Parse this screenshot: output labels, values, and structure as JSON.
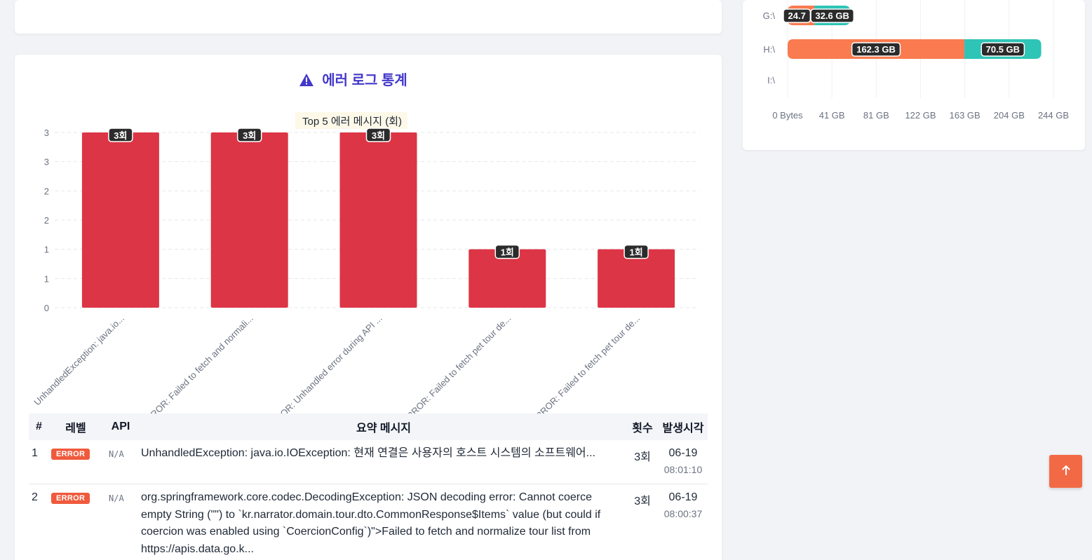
{
  "error_section": {
    "title": "에러 로그 통계",
    "icon": "warning-triangle-icon",
    "accent_color": "#4338ca"
  },
  "chart_data": [
    {
      "type": "bar",
      "title": "Top 5 에러 메시지 (회)",
      "categories": [
        "UnhandledException: java.io...",
        "ERROR: Failed to fetch and normali...",
        "ERROR: Unhandled error during API ...",
        "ERROR: Failed to fetch pet tour de...",
        "ERROR: Failed to fetch pet tour de..."
      ],
      "values": [
        3,
        3,
        3,
        1,
        1
      ],
      "data_labels": [
        "3회",
        "3회",
        "3회",
        "1회",
        "1회"
      ],
      "yticks": [
        "0",
        "1",
        "1",
        "2",
        "2",
        "3",
        "3"
      ],
      "ylim": [
        0,
        3
      ],
      "grid": true,
      "color": "#dc3545"
    },
    {
      "type": "bar",
      "orientation": "horizontal",
      "stacked": true,
      "categories": [
        "G:\\",
        "H:\\",
        "I:\\"
      ],
      "series": [
        {
          "values": [
            24.7,
            162.3,
            0
          ],
          "labels": [
            "24.7",
            "162.3 GB",
            ""
          ],
          "color": "#f97b4f"
        },
        {
          "values": [
            32.6,
            70.5,
            0
          ],
          "labels": [
            "32.6 GB",
            "70.5 GB",
            ""
          ],
          "color": "#2ec4b6"
        }
      ],
      "xticks": [
        "0 Bytes",
        "41 GB",
        "81 GB",
        "122 GB",
        "163 GB",
        "204 GB",
        "244 GB"
      ],
      "xlim": [
        0,
        244
      ],
      "grid": true
    }
  ],
  "table": {
    "headers": [
      "#",
      "레벨",
      "API",
      "요약 메시지",
      "횟수",
      "발생시각"
    ],
    "rows": [
      {
        "index": "1",
        "level": "ERROR",
        "api": "N/A",
        "message": "UnhandledException: java.io.IOException: 현재 연결은 사용자의 호스트 시스템의 소프트웨어...",
        "count": "3회",
        "date": "06-19",
        "time": "08:01:10"
      },
      {
        "index": "2",
        "level": "ERROR",
        "api": "N/A",
        "message": "org.springframework.core.codec.DecodingException: JSON decoding error: Cannot coerce empty String (\"\") to `kr.narrator.domain.tour.dto.CommonResponse$Items` value (but could if coercion was enabled using `CoercionConfig`)\">Failed to fetch and normalize tour list from https://apis.data.go.k...",
        "count": "3회",
        "date": "06-19",
        "time": "08:00:37"
      }
    ]
  },
  "scroll_top": {
    "icon": "arrow-up-icon",
    "color": "#f26a45"
  }
}
